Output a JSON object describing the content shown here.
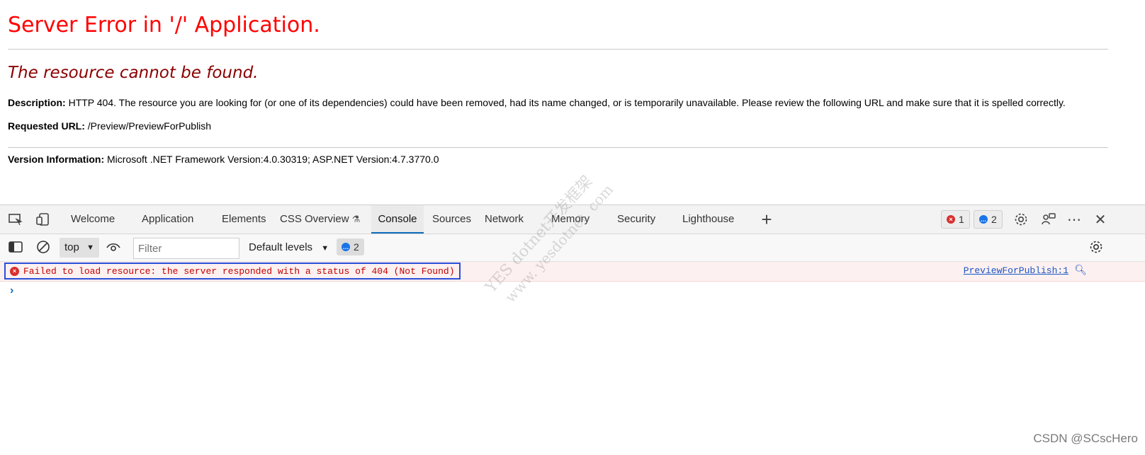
{
  "page": {
    "title": "Server Error in '/' Application.",
    "subtitle": "The resource cannot be found.",
    "description_label": "Description:",
    "description_text": "HTTP 404. The resource you are looking for (or one of its dependencies) could have been removed, had its name changed, or is temporarily unavailable.  Please review the following URL and make sure that it is spelled correctly.",
    "url_label": "Requested URL:",
    "url_text": "/Preview/PreviewForPublish",
    "version_label": "Version Information:",
    "version_text": "Microsoft .NET Framework Version:4.0.30319; ASP.NET Version:4.7.3770.0"
  },
  "devtools": {
    "tabs": [
      {
        "label": "Welcome"
      },
      {
        "label": "Application"
      },
      {
        "label": "Elements"
      },
      {
        "label": "CSS Overview"
      },
      {
        "label": "Console",
        "active": true
      },
      {
        "label": "Sources"
      },
      {
        "label": "Network"
      },
      {
        "label": "Memory"
      },
      {
        "label": "Security"
      },
      {
        "label": "Lighthouse"
      }
    ],
    "error_count": "1",
    "message_count": "2",
    "icons": [
      "inspect-icon",
      "device-emulation-icon",
      "add-tab-icon",
      "settings-icon",
      "feedback-icon",
      "more-icon",
      "close-icon"
    ],
    "accent_color": "#0f6cbd"
  },
  "console": {
    "context": "top",
    "filter_placeholder": "Filter",
    "levels": "Default levels",
    "message_badge": "2",
    "error_message": "Failed to load resource: the server responded with a status of 404 (Not Found)",
    "error_source": "PreviewForPublish:1"
  },
  "watermark": {
    "line1": "YES  dotnet开发框架",
    "line2": "www. yesdotnet. com",
    "credit": "CSDN @SCscHero"
  }
}
